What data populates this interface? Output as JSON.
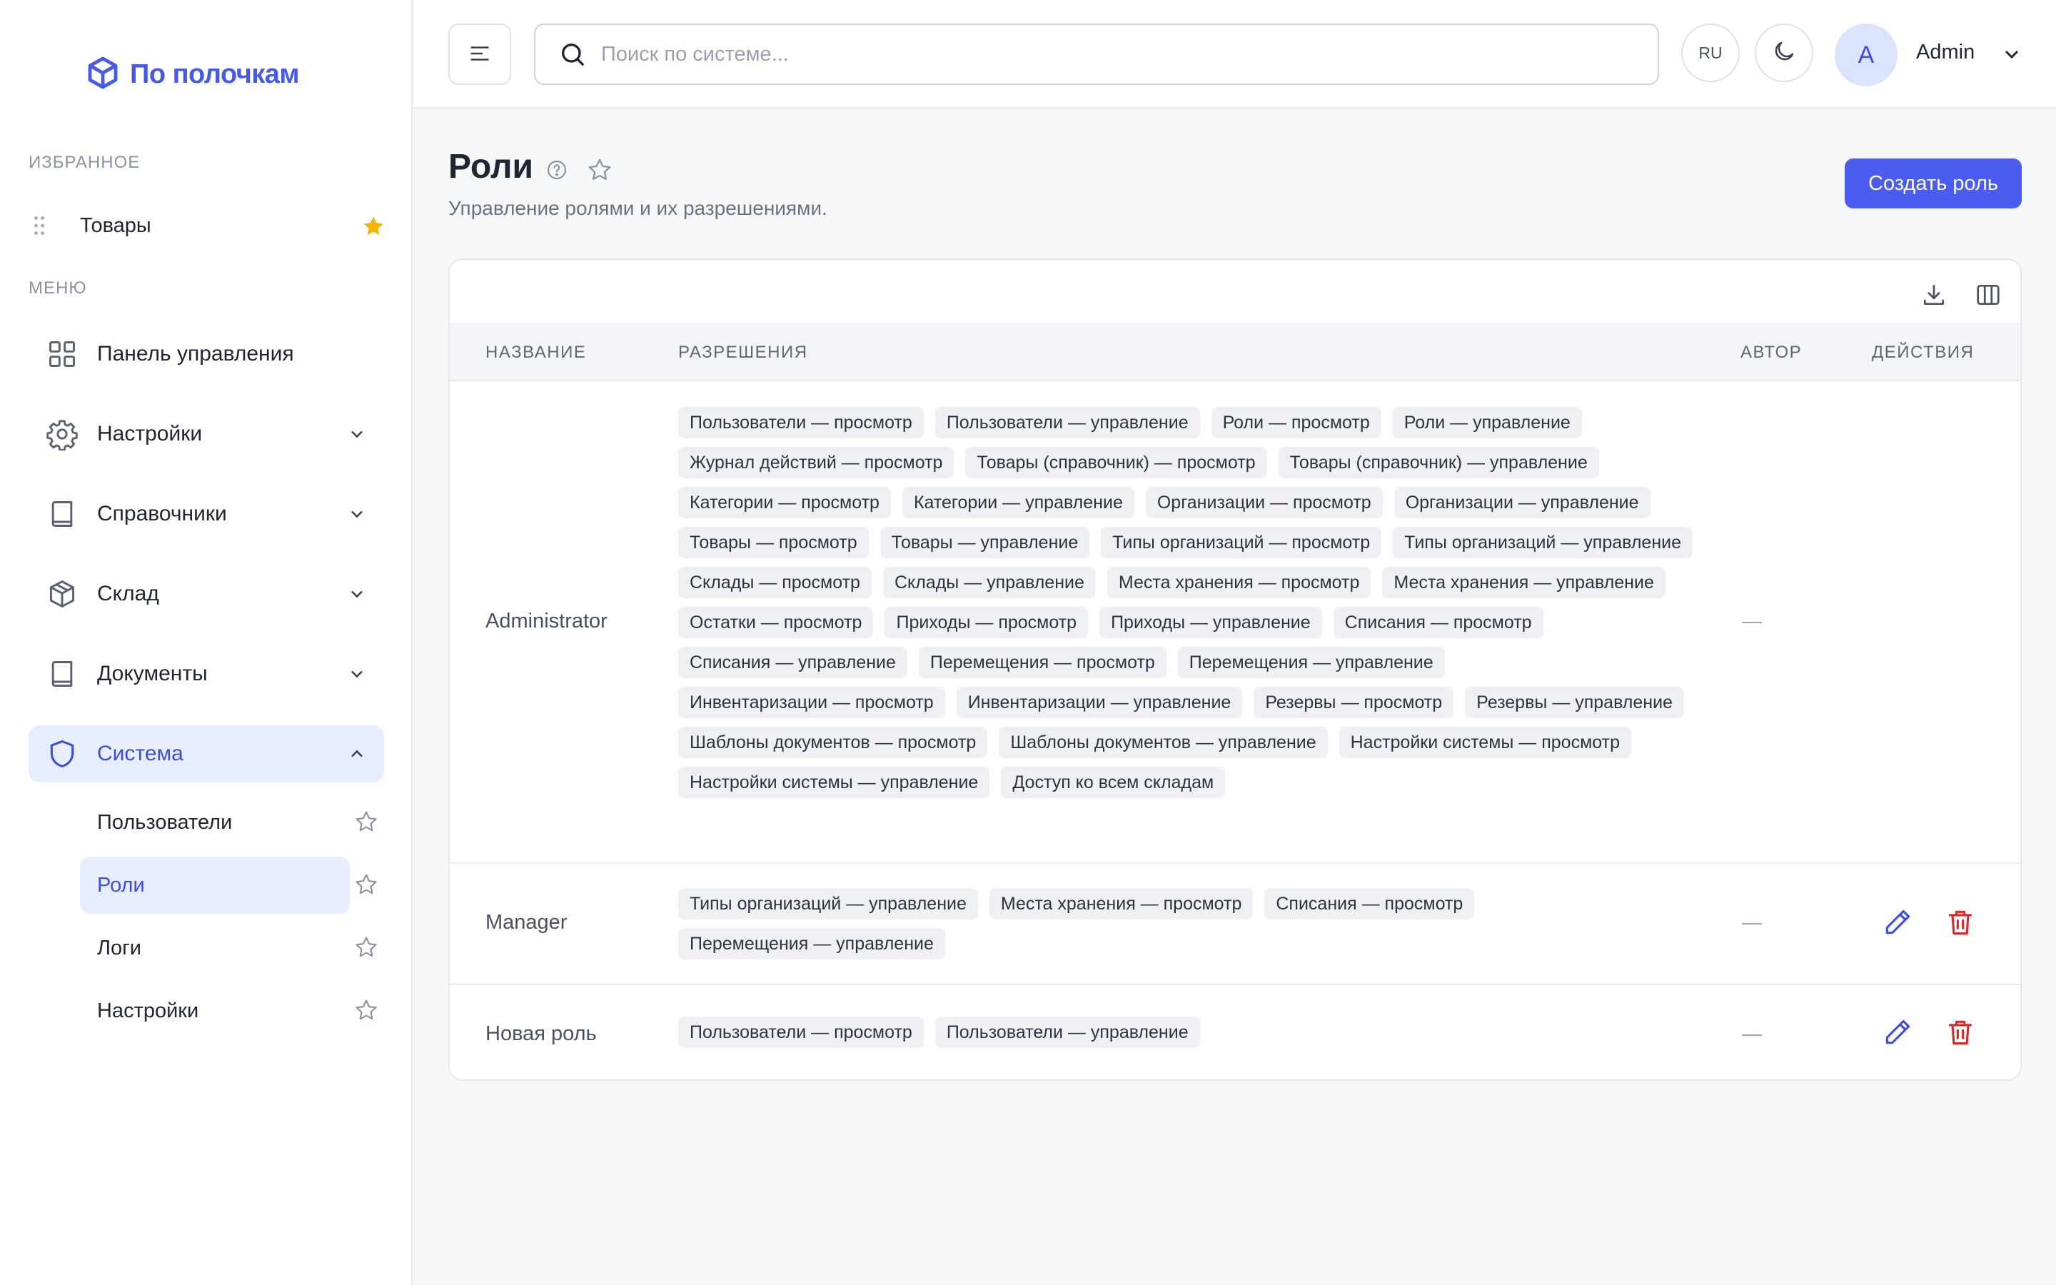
{
  "app": {
    "logo_text": "По полочкам",
    "brand_color": "#4759e8"
  },
  "sidebar": {
    "favorites_title": "ИЗБРАННОЕ",
    "favorites": [
      {
        "label": "Товары",
        "starred": true
      }
    ],
    "menu_title": "МЕНЮ",
    "menu": [
      {
        "label": "Панель управления",
        "icon": "grid-icon"
      },
      {
        "label": "Настройки",
        "icon": "gear-icon"
      },
      {
        "label": "Справочники",
        "icon": "book-icon"
      },
      {
        "label": "Склад",
        "icon": "box-icon"
      },
      {
        "label": "Документы",
        "icon": "document-icon"
      },
      {
        "label": "Система",
        "icon": "shield-icon",
        "expanded": true
      }
    ],
    "system_sub": [
      {
        "label": "Пользователи"
      },
      {
        "label": "Роли",
        "active": true
      },
      {
        "label": "Логи"
      },
      {
        "label": "Настройки"
      }
    ]
  },
  "header": {
    "search_placeholder": "Поиск по системе...",
    "lang": "RU",
    "avatar_initial": "A",
    "user_name": "Admin"
  },
  "page": {
    "title": "Роли",
    "subtitle": "Управление ролями и их разрешениями.",
    "create_button": "Создать роль"
  },
  "table": {
    "columns": {
      "name": "НАЗВАНИЕ",
      "permissions": "РАЗРЕШЕНИЯ",
      "author": "АВТОР",
      "actions": "ДЕЙСТВИЯ"
    },
    "rows": [
      {
        "name": "Administrator",
        "author": "—",
        "permissions": [
          "Пользователи — просмотр",
          "Пользователи — управление",
          "Роли — просмотр",
          "Роли — управление",
          "Журнал действий — просмотр",
          "Товары (справочник) — просмотр",
          "Товары (справочник) — управление",
          "Категории — просмотр",
          "Категории — управление",
          "Организации — просмотр",
          "Организации — управление",
          "Товары — просмотр",
          "Товары — управление",
          "Типы организаций — просмотр",
          "Типы организаций — управление",
          "Склады — просмотр",
          "Склады — управление",
          "Места хранения — просмотр",
          "Места хранения — управление",
          "Остатки — просмотр",
          "Приходы — просмотр",
          "Приходы — управление",
          "Списания — просмотр",
          "Списания — управление",
          "Перемещения — просмотр",
          "Перемещения — управление",
          "Инвентаризации — просмотр",
          "Инвентаризации — управление",
          "Резервы — просмотр",
          "Резервы — управление",
          "Шаблоны документов — просмотр",
          "Шаблоны документов — управление",
          "Настройки системы — просмотр",
          "Настройки системы — управление",
          "Доступ ко всем складам"
        ]
      },
      {
        "name": "Manager",
        "author": "—",
        "permissions": [
          "Типы организаций — управление",
          "Места хранения — просмотр",
          "Списания — просмотр",
          "Перемещения — управление"
        ]
      },
      {
        "name": "Новая роль",
        "author": "—",
        "permissions": [
          "Пользователи — просмотр",
          "Пользователи — управление"
        ]
      }
    ]
  }
}
